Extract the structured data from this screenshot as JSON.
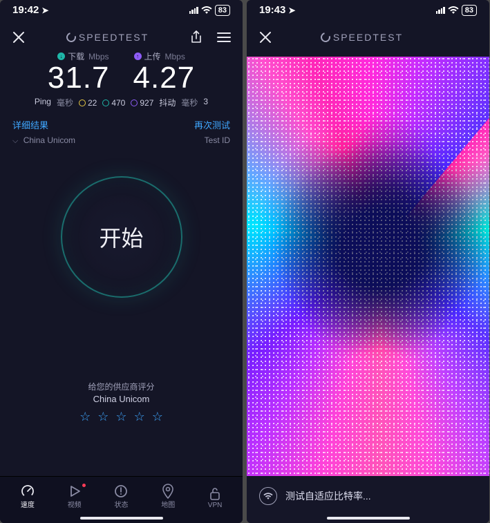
{
  "left": {
    "status": {
      "time": "19:42",
      "battery": "83"
    },
    "brand": "SPEEDTEST",
    "download": {
      "label": "下载",
      "unit": "Mbps",
      "value": "31.7"
    },
    "upload": {
      "label": "上传",
      "unit": "Mbps",
      "value": "4.27"
    },
    "ping": {
      "label": "Ping",
      "unit": "毫秒",
      "idle": "22",
      "down": "470",
      "up": "927",
      "jitter_label": "抖动",
      "jitter_unit": "毫秒",
      "jitter": "3"
    },
    "details_link": "详细结果",
    "retest_link": "再次测试",
    "provider": "China Unicom",
    "test_id_label": "Test ID",
    "go_label": "开始",
    "rating": {
      "prompt": "给您的供应商评分",
      "isp": "China Unicom"
    },
    "tabs": [
      {
        "label": "速度"
      },
      {
        "label": "视频"
      },
      {
        "label": "状态"
      },
      {
        "label": "地图"
      },
      {
        "label": "VPN"
      }
    ]
  },
  "right": {
    "status": {
      "time": "19:43",
      "battery": "83"
    },
    "brand": "SPEEDTEST",
    "bottom_message": "测试自适应比特率..."
  }
}
